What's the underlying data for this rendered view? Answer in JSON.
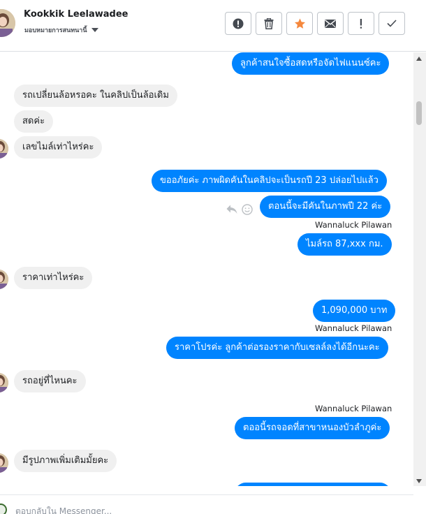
{
  "header": {
    "name": "Kookkik Leelawadee",
    "assign_label": "มอบหมายการสนทนานี้"
  },
  "toolbar": {
    "buttons": [
      {
        "icon": "alert-circle-icon",
        "color": "#444950"
      },
      {
        "icon": "trash-icon",
        "color": "#444950"
      },
      {
        "icon": "star-icon",
        "color": "#f5883d"
      },
      {
        "icon": "envelope-icon",
        "color": "#444950"
      },
      {
        "icon": "exclamation-icon",
        "color": "#444950"
      },
      {
        "icon": "check-icon",
        "color": "#444950"
      }
    ]
  },
  "colors": {
    "outgoing_bubble": "#0084ff",
    "incoming_bubble": "#f0f0f0",
    "star": "#f5883d"
  },
  "messages": {
    "m1": "ลูกค้าสนใจซื้อสดหรือจัดไฟแนนซ์คะ",
    "m2": "รถเปลี่ยนล้อหรอคะ ในคลิปเป็นล้อเดิม",
    "m3": "สดค่ะ",
    "m4": "เลขไมล์เท่าไหร่คะ",
    "m5": "ขออภัยค่ะ ภาพผิดคันในคลิปจะเป็นรถปี 23 ปล่อยไปแล้ว",
    "m6": "ตอนนี้จะมีคันในภาพปี 22  ค่ะ",
    "m7": "ไมล์รถ  87,xxx   กม.",
    "m8": "ราคาเท่าไหร่คะ",
    "m9": "1,090,000 บาท",
    "m10": "ราคาโปรค่ะ  ลูกค้าต่อรองราคากับเซลล์ลงได้อีกนะคะ",
    "m11": "รถอยู่ที่ไหนคะ",
    "m12": "ตออนี้รถจอดที่สาขาหนองบัวลำภูค่ะ",
    "m13": "มีรูปภาพเพิ่มเติมมั้ยคะ"
  },
  "sender_name": "Wannaluck Pilawan",
  "composer": {
    "placeholder": "ตอบกลับใน Messenger..."
  }
}
